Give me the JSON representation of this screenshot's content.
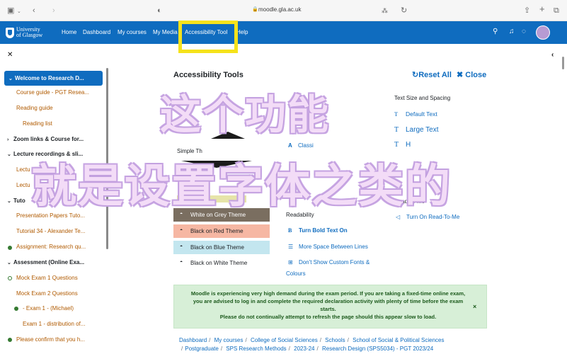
{
  "browser": {
    "url": "moodle.gla.ac.uk"
  },
  "navbar": {
    "logo_line1": "University",
    "logo_line2": "of Glasgow",
    "links": [
      "Home",
      "Dashboard",
      "My courses",
      "My Media",
      "Accessibility Tool",
      "Help"
    ]
  },
  "sidebar": {
    "items": [
      {
        "label": "Welcome to Research D...",
        "kind": "active"
      },
      {
        "label": "Course guide - PGT Resea..."
      },
      {
        "label": "Reading guide"
      },
      {
        "label": "Reading list"
      },
      {
        "label": "Zoom links & Course for...",
        "kind": "section"
      },
      {
        "label": "Lecture recordings & sli...",
        "kind": "section"
      },
      {
        "label": "Lectu"
      },
      {
        "label": "Lectu"
      },
      {
        "label": "Tuto",
        "kind": "section"
      },
      {
        "label": "Presentation Papers Tuto..."
      },
      {
        "label": "Tutorial 34 - Alexander Te..."
      },
      {
        "label": "Assignment: Research qu..."
      },
      {
        "label": "Assessment (Online Exa...",
        "kind": "section"
      },
      {
        "label": "Mock Exam 1 Questions"
      },
      {
        "label": "Mock Exam 2 Questions"
      },
      {
        "label": "- Exam 1 - (Michael)"
      },
      {
        "label": "Exam 1 - distribution of..."
      },
      {
        "label": "Please confirm that you h..."
      }
    ]
  },
  "accessibility": {
    "title": "Accessibility Tools",
    "reset_label": "Reset All",
    "close_label": "Close",
    "text_size_heading": "Text Size and Spacing",
    "text_size_options": [
      "Default Text",
      "Large Text",
      "H"
    ],
    "simple_heading": "Simple Th",
    "partial_fo": "Fo",
    "partial_classic": "Classi",
    "themes": [
      "White on Grey Theme",
      "Black on Red Theme",
      "Black on Blue Theme",
      "Black on White Theme"
    ],
    "readability_heading": "Readability",
    "readability_options": [
      "Turn Bold Text On",
      "More Space Between Lines",
      "Don't Show Custom Fonts &"
    ],
    "readability_colours": "Colours",
    "read_to_me_heading": "Read To Me",
    "read_to_me_option": "Turn On Read-To-Me"
  },
  "alert": {
    "line1": "Moodle is experiencing very high demand during the exam period. If you are taking a fixed-time online exam, you are advised to log in and complete the required declaration activity with plenty of time before the exam starts.",
    "line2": "Please do not continually attempt to refresh the page should this appear slow to load.",
    "close": "×"
  },
  "breadcrumbs": {
    "row1": [
      "Dashboard",
      "My courses",
      "College of Social Sciences",
      "Schools",
      "School of Social & Political Sciences"
    ],
    "row2": [
      "Postgraduate",
      "SPS Research Methods",
      "2023-24",
      "Research Design (SPS5034) - PGT 2023/24"
    ]
  },
  "overlay": {
    "line1": "这个功能",
    "line2": "就是设置字体之类的"
  },
  "colors": {
    "brand": "#0f6cbf",
    "highlight": "#f5e21b",
    "overlay": "#c9a8e4"
  }
}
